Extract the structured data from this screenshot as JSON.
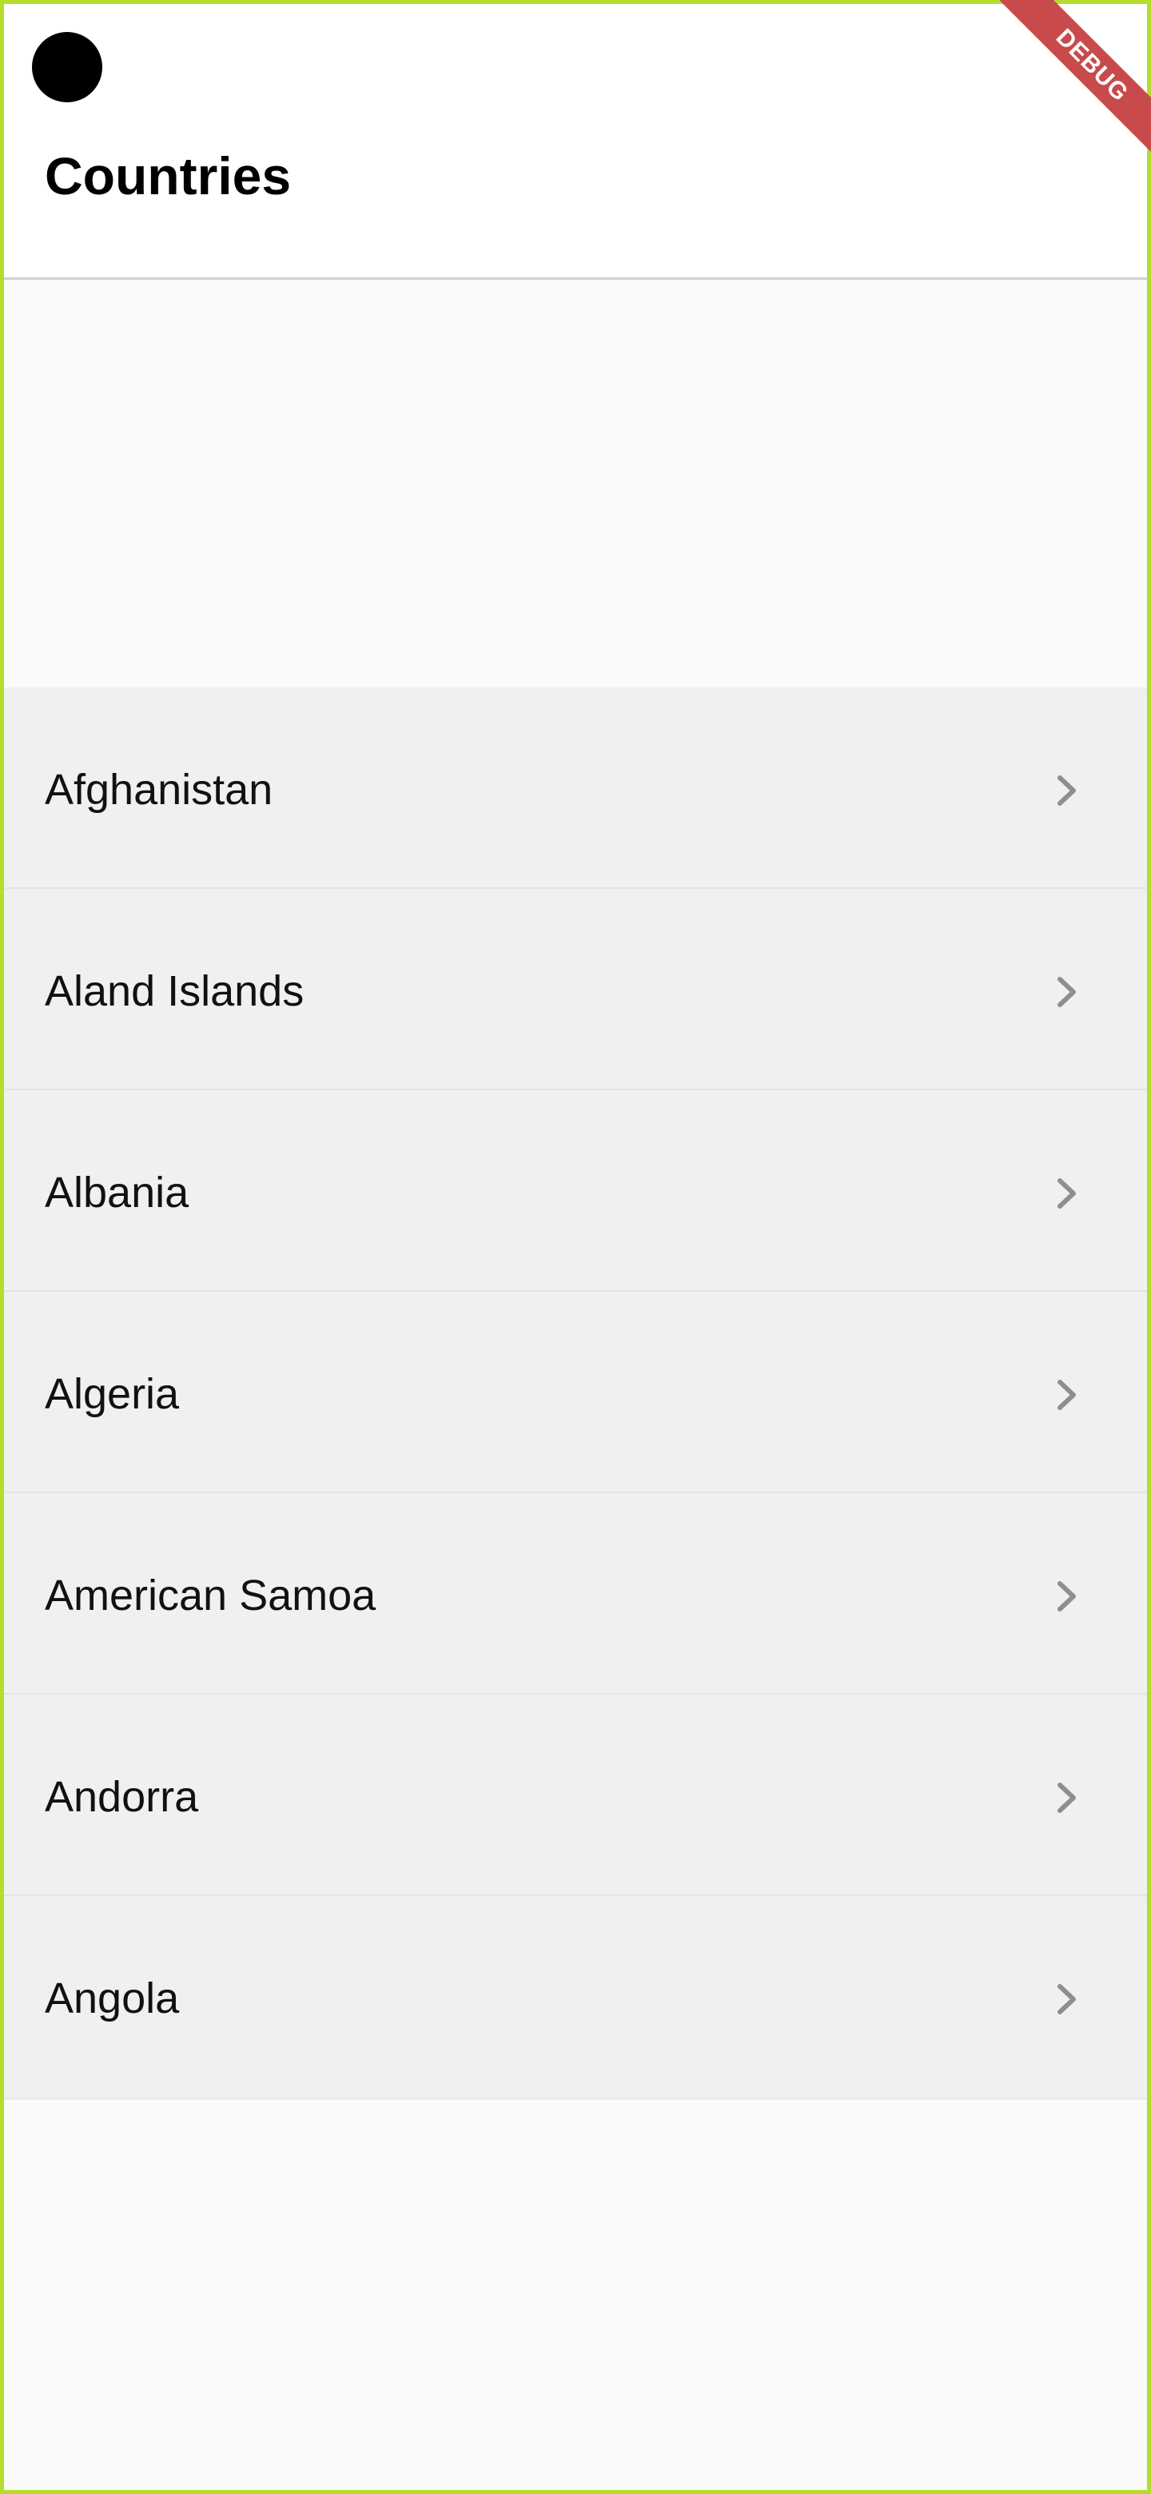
{
  "app_bar": {
    "title": "Countries"
  },
  "debug_banner": {
    "label": "DEBUG"
  },
  "countries": [
    "Afghanistan",
    "Aland Islands",
    "Albania",
    "Algeria",
    "American Samoa",
    "Andorra",
    "Angola"
  ],
  "colors": {
    "frame": "#b5dd2e",
    "background": "#fafafa",
    "app_bar": "#ffffff",
    "list_item": "#f0f0f0",
    "divider": "#e4e4e4",
    "chevron": "#8e8e8e",
    "debug_banner": "#c84a4a"
  },
  "icons": {
    "list_item_trailing": "chevron-right-icon",
    "status": "black-dot-icon"
  }
}
